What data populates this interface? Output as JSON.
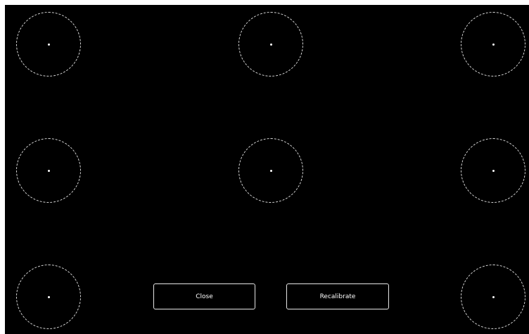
{
  "colors": {
    "background": "#000000",
    "target_ring": "#d9d9d9",
    "target_dot": "#ffffff",
    "button_border": "#e6e6e6",
    "button_text": "#ffffff"
  },
  "buttons": {
    "close_label": "Close",
    "recalibrate_label": "Recalibrate"
  },
  "calibration_targets": [
    {
      "row": "top",
      "column": "left"
    },
    {
      "row": "top",
      "column": "center"
    },
    {
      "row": "top",
      "column": "right"
    },
    {
      "row": "middle",
      "column": "left"
    },
    {
      "row": "middle",
      "column": "center"
    },
    {
      "row": "middle",
      "column": "right"
    },
    {
      "row": "bottom",
      "column": "left"
    },
    {
      "row": "bottom",
      "column": "right"
    }
  ]
}
